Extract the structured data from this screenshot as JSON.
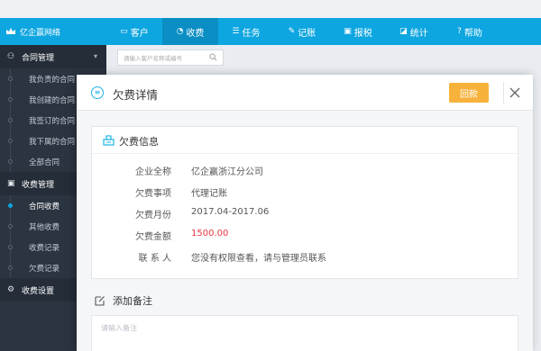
{
  "app": {
    "name": "亿企赢网络"
  },
  "nav": [
    {
      "label": "客户",
      "icon": "monitor-icon",
      "glyph": "▭",
      "width": 62
    },
    {
      "label": "收费",
      "icon": "user-icon",
      "glyph": "◔",
      "width": 62,
      "active": true
    },
    {
      "label": "任务",
      "icon": "list-icon",
      "glyph": "☰",
      "width": 62
    },
    {
      "label": "记账",
      "icon": "edit-icon",
      "glyph": "✎",
      "width": 62
    },
    {
      "label": "报税",
      "icon": "document-icon",
      "glyph": "▣",
      "width": 62
    },
    {
      "label": "统计",
      "icon": "chart-icon",
      "glyph": "◪",
      "width": 62
    },
    {
      "label": "帮助",
      "icon": "help-icon",
      "glyph": "?",
      "width": 62
    }
  ],
  "sidebar": {
    "groups": [
      {
        "label": "合同管理",
        "icon": "person-icon",
        "glyph": "⚇",
        "items": [
          {
            "label": "我负责的合同"
          },
          {
            "label": "我创建的合同"
          },
          {
            "label": "我签订的合同"
          },
          {
            "label": "我下属的合同"
          },
          {
            "label": "全部合同"
          }
        ]
      },
      {
        "label": "收费管理",
        "icon": "cash-icon",
        "glyph": "▣",
        "items": [
          {
            "label": "合同收费",
            "active": true
          },
          {
            "label": "其他收费"
          },
          {
            "label": "收费记录"
          },
          {
            "label": "欠费记录"
          }
        ]
      },
      {
        "label": "收费设置",
        "icon": "settings-icon",
        "glyph": "⚙",
        "items": []
      }
    ]
  },
  "search": {
    "placeholder": "请输入客户名称或编号"
  },
  "modal": {
    "title": "欠费详情",
    "refund_label": "回款",
    "card_title": "欠费信息",
    "fields": [
      {
        "label": "企业全称",
        "value": "亿企赢浙江分公司"
      },
      {
        "label": "欠费事项",
        "value": "代理记账"
      },
      {
        "label": "欠费月份",
        "value": "2017.04-2017.06"
      },
      {
        "label": "欠费金额",
        "value": "1500.00",
        "highlight": true
      },
      {
        "label": "联 系 人",
        "value": "您没有权限查看，请与管理员联系"
      }
    ],
    "note_title": "添加备注",
    "note_placeholder": "请输入备注"
  },
  "colors": {
    "primary": "#0ea6e0",
    "sidebar": "#2b3441",
    "accent": "#f7b23b",
    "danger": "#e9383f"
  }
}
